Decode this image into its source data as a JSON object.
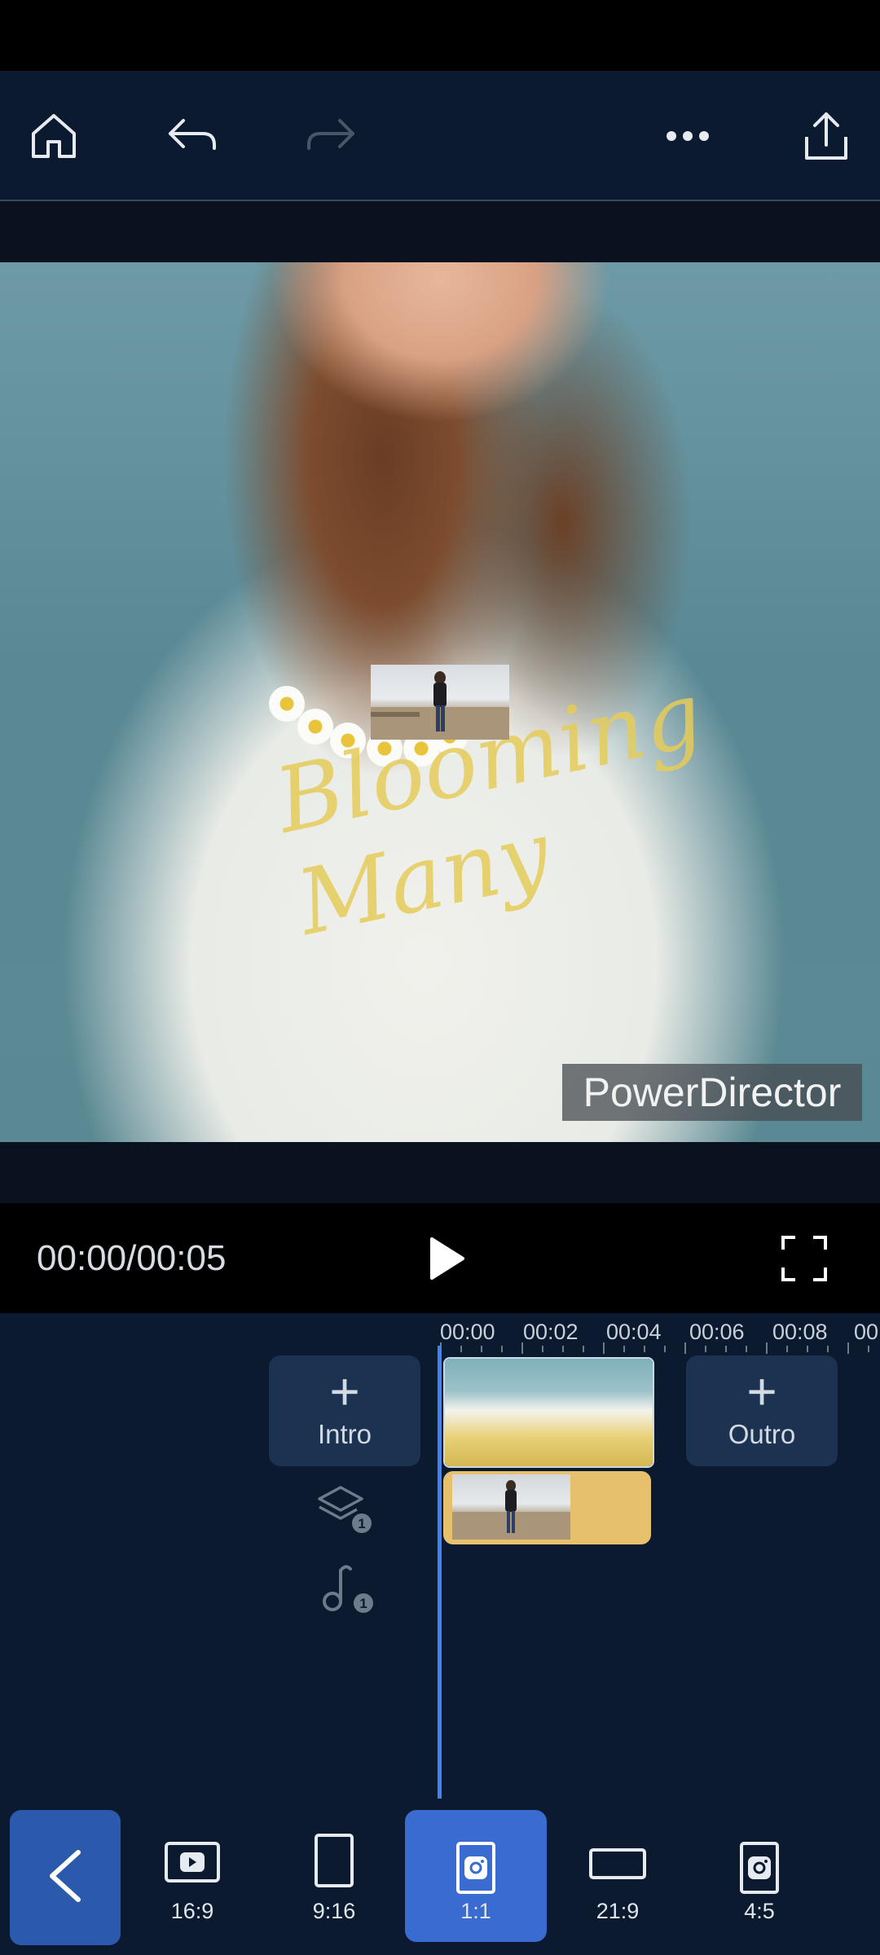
{
  "toolbar": {
    "icons": [
      "home-icon",
      "undo-icon",
      "redo-icon",
      "more-icon",
      "share-icon"
    ]
  },
  "preview": {
    "watermark": "PowerDirector",
    "shirt_text": "Blooming Many"
  },
  "playback": {
    "time": "00:00/00:05",
    "play_icon": "play-icon",
    "fullscreen_icon": "fullscreen-icon"
  },
  "timeline": {
    "ruler": [
      "00:00",
      "00:02",
      "00:04",
      "00:06",
      "00:08",
      "00"
    ],
    "intro_label": "Intro",
    "outro_label": "Outro",
    "layer_count": "1",
    "music_count": "1"
  },
  "aspect_ratios": {
    "options": [
      {
        "label": "16:9",
        "icon": "youtube-icon",
        "selected": false
      },
      {
        "label": "9:16",
        "icon": "portrait-frame-icon",
        "selected": false
      },
      {
        "label": "1:1",
        "icon": "instagram-icon",
        "selected": true
      },
      {
        "label": "21:9",
        "icon": "widescreen-frame-icon",
        "selected": false
      },
      {
        "label": "4:5",
        "icon": "instagram-icon",
        "selected": false
      }
    ]
  },
  "colors": {
    "toolbar_bg": "#0b1a2f",
    "accent": "#3a6bd0",
    "playhead": "#3f84f0",
    "overlay_clip": "#e6c06c"
  }
}
